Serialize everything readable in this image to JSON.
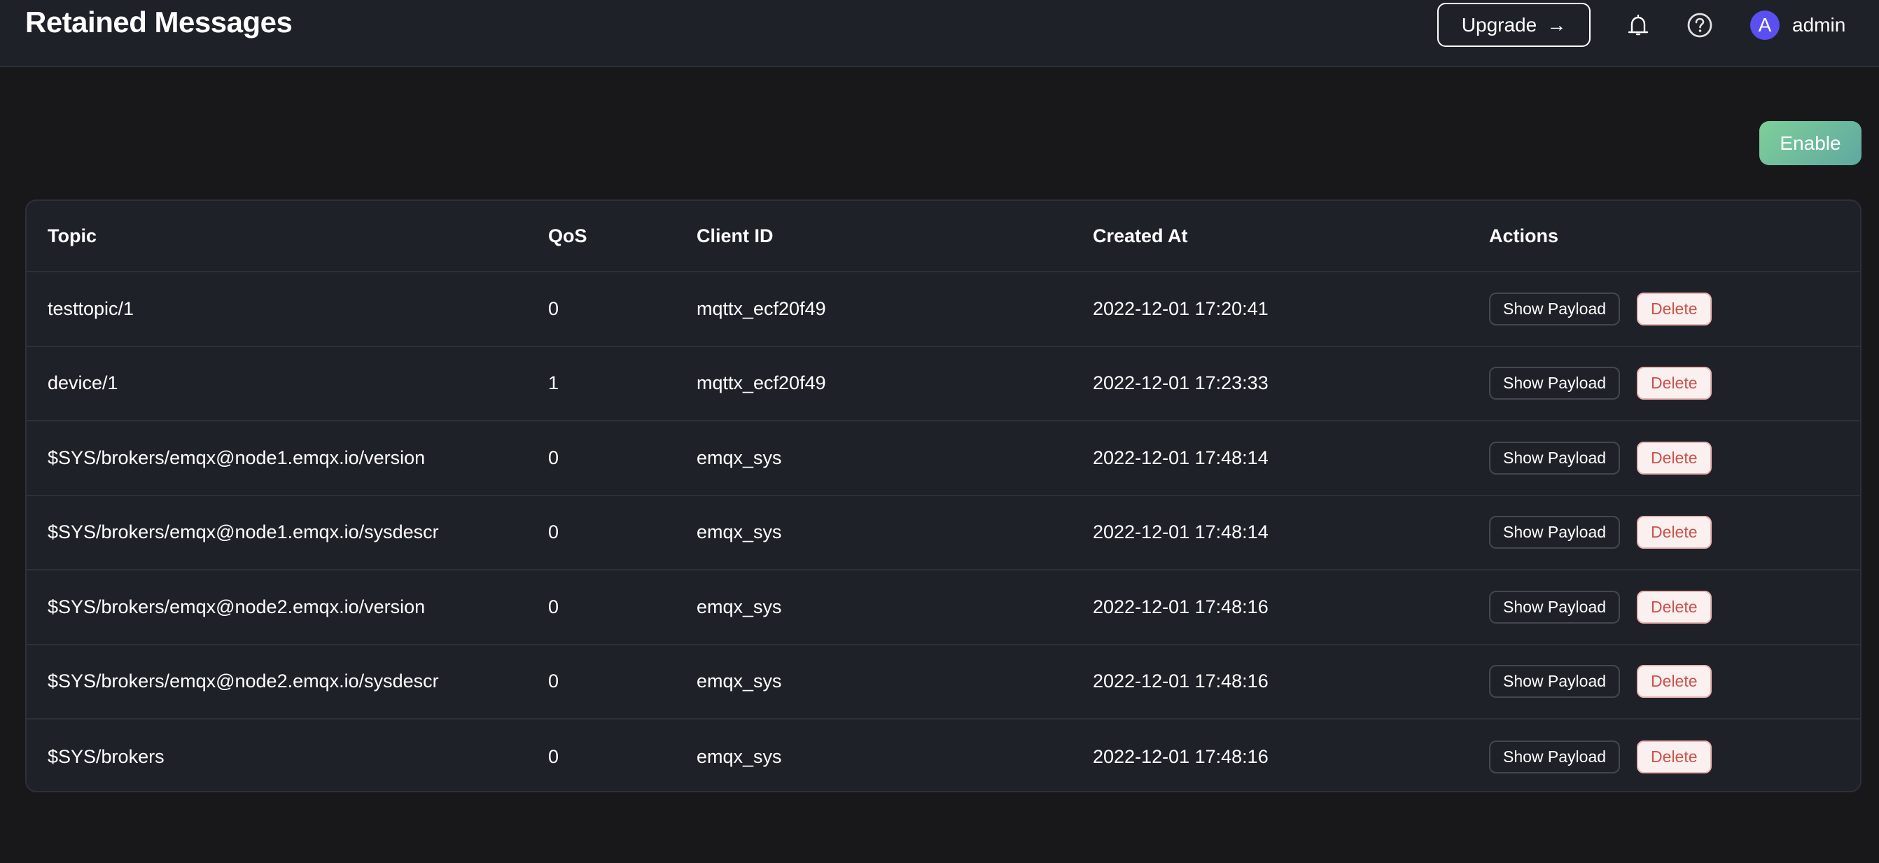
{
  "header": {
    "title": "Retained Messages",
    "upgrade_label": "Upgrade",
    "upgrade_arrow": "→",
    "icons": {
      "notifications": "bell-icon",
      "help": "help-circle-icon"
    },
    "user": {
      "avatar_initial": "A",
      "name": "admin",
      "avatar_color": "#5a4ff0"
    }
  },
  "toolbar": {
    "enable_label": "Enable",
    "enable_colors": [
      "#7fcf9a",
      "#5fa8a0"
    ]
  },
  "table": {
    "columns": [
      "Topic",
      "QoS",
      "Client ID",
      "Created At",
      "Actions"
    ],
    "rows": [
      {
        "topic": "testtopic/1",
        "qos": "0",
        "client_id": "mqttx_ecf20f49",
        "created_at": "2022-12-01 17:20:41",
        "show_label": "Show Payload",
        "delete_label": "Delete"
      },
      {
        "topic": "device/1",
        "qos": "1",
        "client_id": "mqttx_ecf20f49",
        "created_at": "2022-12-01 17:23:33",
        "show_label": "Show Payload",
        "delete_label": "Delete"
      },
      {
        "topic": "$SYS/brokers/emqx@node1.emqx.io/version",
        "qos": "0",
        "client_id": "emqx_sys",
        "created_at": "2022-12-01 17:48:14",
        "show_label": "Show Payload",
        "delete_label": "Delete"
      },
      {
        "topic": "$SYS/brokers/emqx@node1.emqx.io/sysdescr",
        "qos": "0",
        "client_id": "emqx_sys",
        "created_at": "2022-12-01 17:48:14",
        "show_label": "Show Payload",
        "delete_label": "Delete"
      },
      {
        "topic": "$SYS/brokers/emqx@node2.emqx.io/version",
        "qos": "0",
        "client_id": "emqx_sys",
        "created_at": "2022-12-01 17:48:16",
        "show_label": "Show Payload",
        "delete_label": "Delete"
      },
      {
        "topic": "$SYS/brokers/emqx@node2.emqx.io/sysdescr",
        "qos": "0",
        "client_id": "emqx_sys",
        "created_at": "2022-12-01 17:48:16",
        "show_label": "Show Payload",
        "delete_label": "Delete"
      },
      {
        "topic": "$SYS/brokers",
        "qos": "0",
        "client_id": "emqx_sys",
        "created_at": "2022-12-01 17:48:16",
        "show_label": "Show Payload",
        "delete_label": "Delete"
      }
    ]
  },
  "colors": {
    "page_bg": "#18181b",
    "surface_bg": "#1f2129",
    "border": "#2e3039",
    "delete_text": "#c9524b",
    "delete_bg": "#faf0ef"
  }
}
